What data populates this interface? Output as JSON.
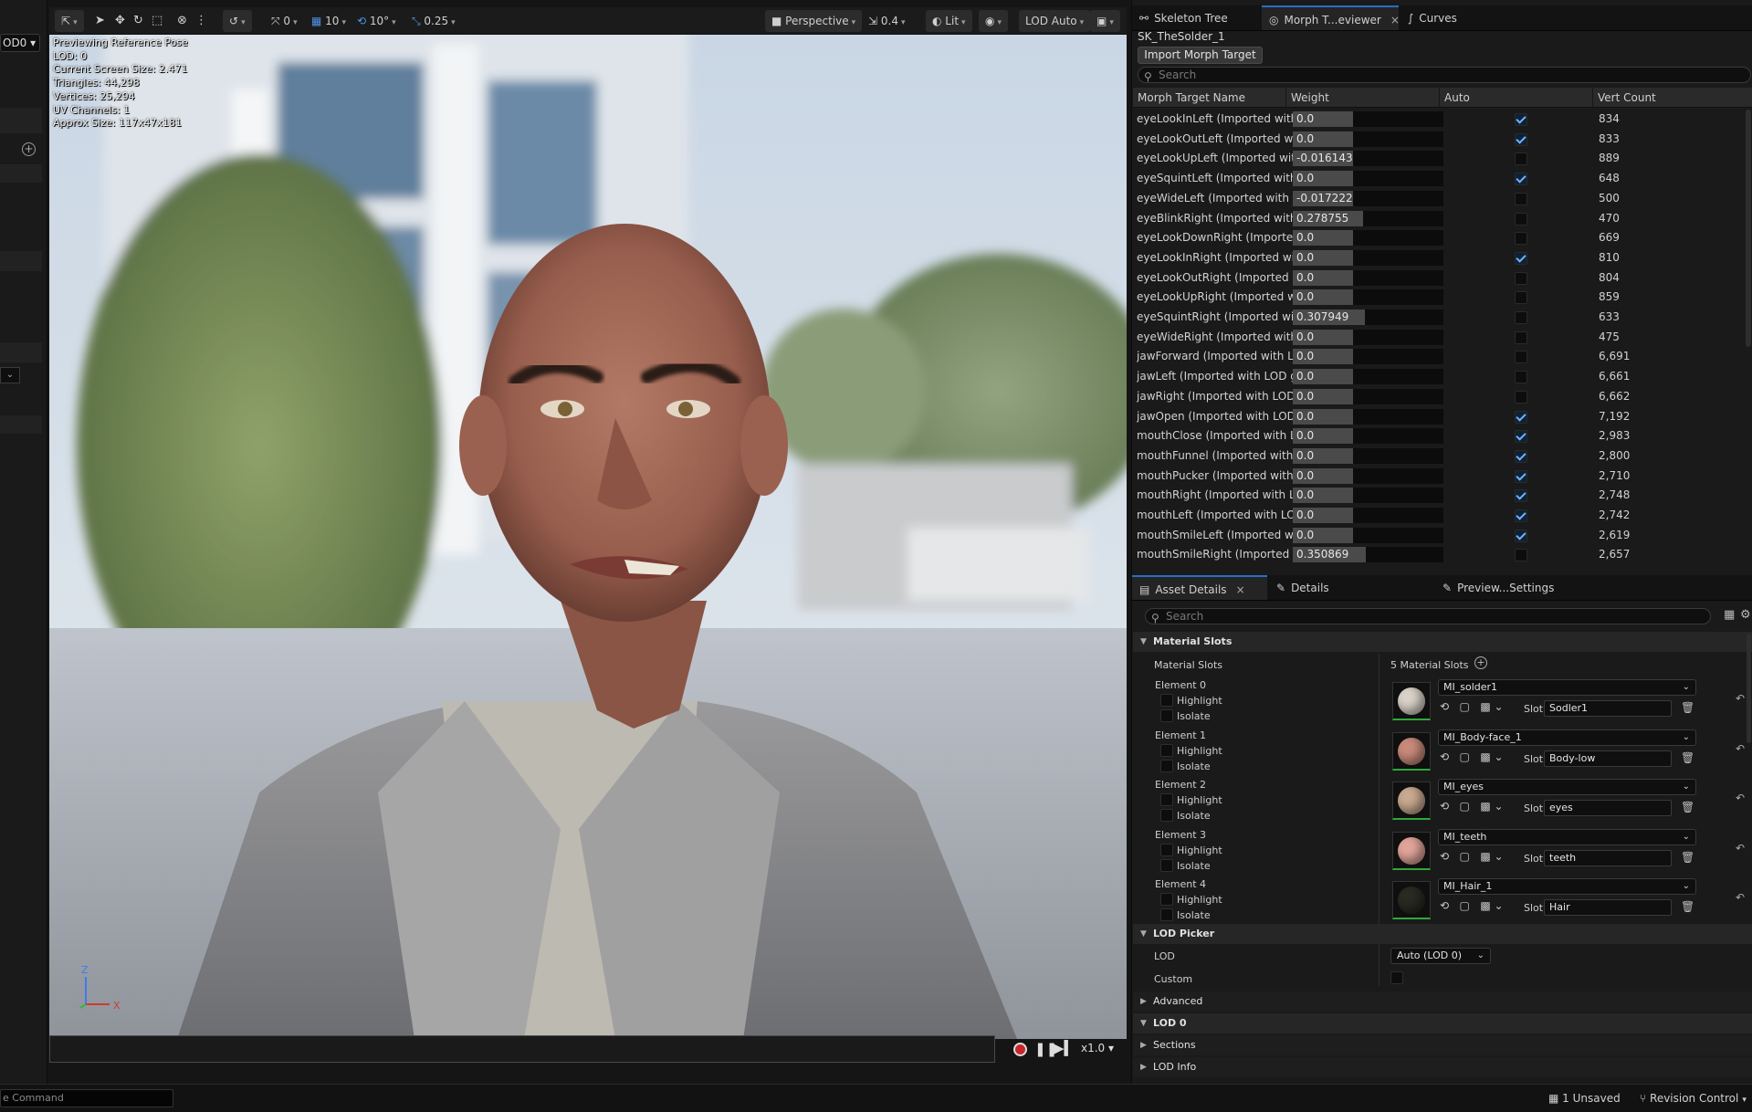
{
  "left_strip": {
    "lod_dropdown": "OD0 ▾",
    "add_icon": "plus-circle-icon"
  },
  "viewport": {
    "toolbar": {
      "snap_translate": "0",
      "grid_size": "10",
      "rotate_snap": "10°",
      "scale_snap": "0.25",
      "view_mode": "Perspective",
      "camera_speed": "0.4",
      "lighting": "Lit",
      "lod_mode": "LOD Auto"
    },
    "overlay_lines": [
      "Previewing Reference Pose",
      "LOD: 0",
      "Current Screen Size: 2.471",
      "Triangles: 44,298",
      "Vertices: 25,294",
      "UV Channels: 1",
      "Approx Size: 117x47x181"
    ],
    "axis_labels": {
      "z": "Z",
      "x": "X"
    },
    "timeline": {
      "speed": "x1.0 ▾"
    }
  },
  "morph_panel": {
    "tabs": [
      {
        "label": "Skeleton Tree",
        "icon": "skeleton-tree-icon"
      },
      {
        "label": "Morph T...eviewer",
        "icon": "morph-target-icon",
        "close": "×"
      },
      {
        "label": "Curves",
        "icon": "curve-icon"
      }
    ],
    "asset_name": "SK_TheSolder_1",
    "import_button": "Import Morph Target",
    "search_placeholder": "Search",
    "columns": [
      "Morph Target Name",
      "Weight",
      "Auto",
      "Vert Count"
    ],
    "rows": [
      {
        "name": "eyeLookInLeft (Imported with LOD geometry)",
        "weight": 0.0,
        "weight_text": "0.0",
        "auto": true,
        "verts": "834"
      },
      {
        "name": "eyeLookOutLeft (Imported with LOD geometry)",
        "weight": 0.0,
        "weight_text": "0.0",
        "auto": true,
        "verts": "833"
      },
      {
        "name": "eyeLookUpLeft (Imported with LOD geometry)",
        "weight": 0.0,
        "weight_text": "-0.016143",
        "auto": false,
        "verts": "889"
      },
      {
        "name": "eyeSquintLeft (Imported with LOD geometry)",
        "weight": 0.0,
        "weight_text": "0.0",
        "auto": true,
        "verts": "648"
      },
      {
        "name": "eyeWideLeft (Imported with LOD geometry)",
        "weight": 0.0,
        "weight_text": "-0.017222",
        "auto": false,
        "verts": "500"
      },
      {
        "name": "eyeBlinkRight (Imported with LOD geometry)",
        "weight": 0.278755,
        "weight_text": "0.278755",
        "auto": false,
        "verts": "470"
      },
      {
        "name": "eyeLookDownRight (Imported with LOD geometry)",
        "weight": 0.0,
        "weight_text": "0.0",
        "auto": false,
        "verts": "669"
      },
      {
        "name": "eyeLookInRight (Imported with LOD geometry)",
        "weight": 0.0,
        "weight_text": "0.0",
        "auto": true,
        "verts": "810"
      },
      {
        "name": "eyeLookOutRight (Imported with LOD geometry)",
        "weight": 0.0,
        "weight_text": "0.0",
        "auto": false,
        "verts": "804"
      },
      {
        "name": "eyeLookUpRight (Imported with LOD geometry)",
        "weight": 0.0,
        "weight_text": "0.0",
        "auto": false,
        "verts": "859"
      },
      {
        "name": "eyeSquintRight (Imported with LOD geometry)",
        "weight": 0.307949,
        "weight_text": "0.307949",
        "auto": false,
        "verts": "633"
      },
      {
        "name": "eyeWideRight (Imported with LOD geometry)",
        "weight": 0.0,
        "weight_text": "0.0",
        "auto": false,
        "verts": "475"
      },
      {
        "name": "jawForward (Imported with LOD geometry)",
        "weight": 0.0,
        "weight_text": "0.0",
        "auto": false,
        "verts": "6,691"
      },
      {
        "name": "jawLeft (Imported with LOD geometry)",
        "weight": 0.0,
        "weight_text": "0.0",
        "auto": false,
        "verts": "6,661"
      },
      {
        "name": "jawRight (Imported with LOD geometry)",
        "weight": 0.0,
        "weight_text": "0.0",
        "auto": false,
        "verts": "6,662"
      },
      {
        "name": "jawOpen (Imported with LOD geometry)",
        "weight": 0.0,
        "weight_text": "0.0",
        "auto": true,
        "verts": "7,192"
      },
      {
        "name": "mouthClose (Imported with LOD geometry)",
        "weight": 0.0,
        "weight_text": "0.0",
        "auto": true,
        "verts": "2,983"
      },
      {
        "name": "mouthFunnel (Imported with LOD geometry)",
        "weight": 0.0,
        "weight_text": "0.0",
        "auto": true,
        "verts": "2,800"
      },
      {
        "name": "mouthPucker (Imported with LOD geometry)",
        "weight": 0.0,
        "weight_text": "0.0",
        "auto": true,
        "verts": "2,710"
      },
      {
        "name": "mouthRight (Imported with LOD geometry)",
        "weight": 0.0,
        "weight_text": "0.0",
        "auto": true,
        "verts": "2,748"
      },
      {
        "name": "mouthLeft (Imported with LOD geometry)",
        "weight": 0.0,
        "weight_text": "0.0",
        "auto": true,
        "verts": "2,742"
      },
      {
        "name": "mouthSmileLeft (Imported with LOD geometry)",
        "weight": 0.0,
        "weight_text": "0.0",
        "auto": true,
        "verts": "2,619"
      },
      {
        "name": "mouthSmileRight (Imported with LOD geometry)",
        "weight": 0.350869,
        "weight_text": "0.350869",
        "auto": false,
        "verts": "2,657"
      }
    ]
  },
  "details_panel": {
    "tabs": [
      {
        "label": "Asset Details",
        "icon": "asset-details-icon",
        "close": "×"
      },
      {
        "label": "Details",
        "icon": "pencil-icon"
      },
      {
        "label": "Preview...Settings",
        "icon": "pencil-icon"
      }
    ],
    "search_placeholder": "Search",
    "material_slots_section": "Material Slots",
    "material_slots_label": "Material Slots",
    "material_slots_count": "5 Material Slots",
    "highlight_label": "Highlight",
    "isolate_label": "Isolate",
    "slot_label": "Slot",
    "elements": [
      {
        "label": "Element 0",
        "material": "MI_solder1",
        "slot": "Sodler1",
        "thumb_color": "#d9d2c8"
      },
      {
        "label": "Element 1",
        "material": "MI_Body-face_1",
        "slot": "Body-low",
        "thumb_color": "#c98a7a"
      },
      {
        "label": "Element 2",
        "material": "MI_eyes",
        "slot": "eyes",
        "thumb_color": "#c9a98f"
      },
      {
        "label": "Element 3",
        "material": "MI_teeth",
        "slot": "teeth",
        "thumb_color": "#e0a49a"
      },
      {
        "label": "Element 4",
        "material": "MI_Hair_1",
        "slot": "Hair",
        "thumb_color": "#2a2a22"
      }
    ],
    "lod_picker_section": "LOD Picker",
    "lod_label": "LOD",
    "lod_value": "Auto (LOD 0)",
    "custom_label": "Custom",
    "advanced_section": "Advanced",
    "lod0_section": "LOD 0",
    "sections_label": "Sections",
    "lod_info_label": "LOD Info"
  },
  "status_bar": {
    "command_placeholder": "e  Command",
    "unsaved": "1 Unsaved",
    "revision_control": "Revision Control"
  },
  "colors": {
    "accent": "#2b6cc4",
    "checkbox_check": "#6fb2ff",
    "record": "#c8262b",
    "thumb_border": "#2fa83a"
  }
}
